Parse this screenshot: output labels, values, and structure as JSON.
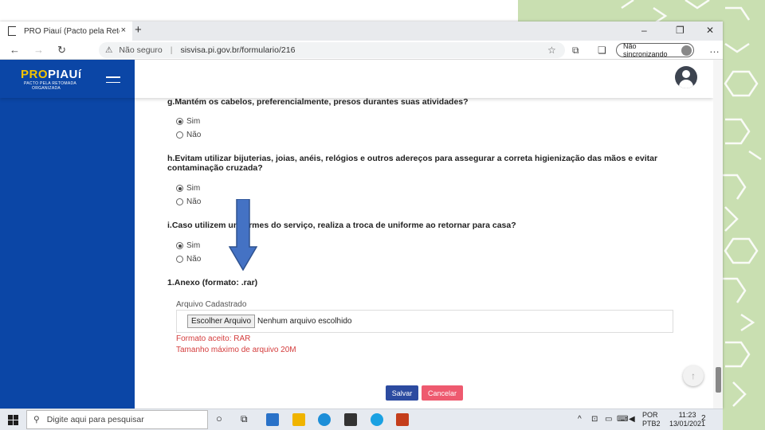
{
  "browser": {
    "tab_title": "PRO Piauí (Pacto pela Retomada",
    "tab_close": "×",
    "new_tab": "+",
    "minimize": "–",
    "restore": "❐",
    "close": "✕",
    "back": "←",
    "forward": "→",
    "reload": "↻",
    "security_warning": "Não seguro",
    "url": "sisvisa.pi.gov.br/formulario/216",
    "sync_label": "Não sincronizando",
    "more": "…"
  },
  "app": {
    "logo_text": "PROPIAUÍ",
    "logo_pro": "PRO",
    "logo_rest": "PIAUí",
    "logo_subtitle_1": "PACTO PELA RETOMADA",
    "logo_subtitle_2": "ORGANIZADA"
  },
  "form": {
    "questions": [
      {
        "label": "g.Mantém os cabelos, preferencialmente, presos durantes suas atividades?",
        "options": [
          "Sim",
          "Não"
        ],
        "selected": "Sim"
      },
      {
        "label": "h.Evitam utilizar bijuterias, joias, anéis, relógios e outros adereços para assegurar a correta higienização das mãos e evitar contaminação cruzada?",
        "options": [
          "Sim",
          "Não"
        ],
        "selected": "Sim"
      },
      {
        "label": "i.Caso utilizem uniformes do serviço, realiza a troca de uniforme ao retornar para casa?",
        "options": [
          "Sim",
          "Não"
        ],
        "selected": "Sim"
      }
    ],
    "attachment": {
      "title": "1.Anexo (formato: .rar)",
      "label": "Arquivo Cadastrado",
      "choose_button": "Escolher Arquivo",
      "no_file": "Nenhum arquivo escolhido",
      "format_note": "Formato aceito: RAR",
      "size_note": "Tamanho máximo de arquivo 20M"
    },
    "save_button": "Salvar",
    "cancel_button": "Cancelar"
  },
  "taskbar": {
    "search_placeholder": "Digite aqui para pesquisar",
    "language_1": "POR",
    "language_2": "PTB2",
    "time": "11:23",
    "date": "13/01/2021",
    "notifications": "2"
  },
  "colors": {
    "sidebar": "#0b46a6",
    "save": "#2c4ba0",
    "cancel": "#ee5a6f",
    "warning_text": "#d43c3c",
    "deco_green": "#c9dfb1",
    "arrow_fill": "#4472c4"
  }
}
